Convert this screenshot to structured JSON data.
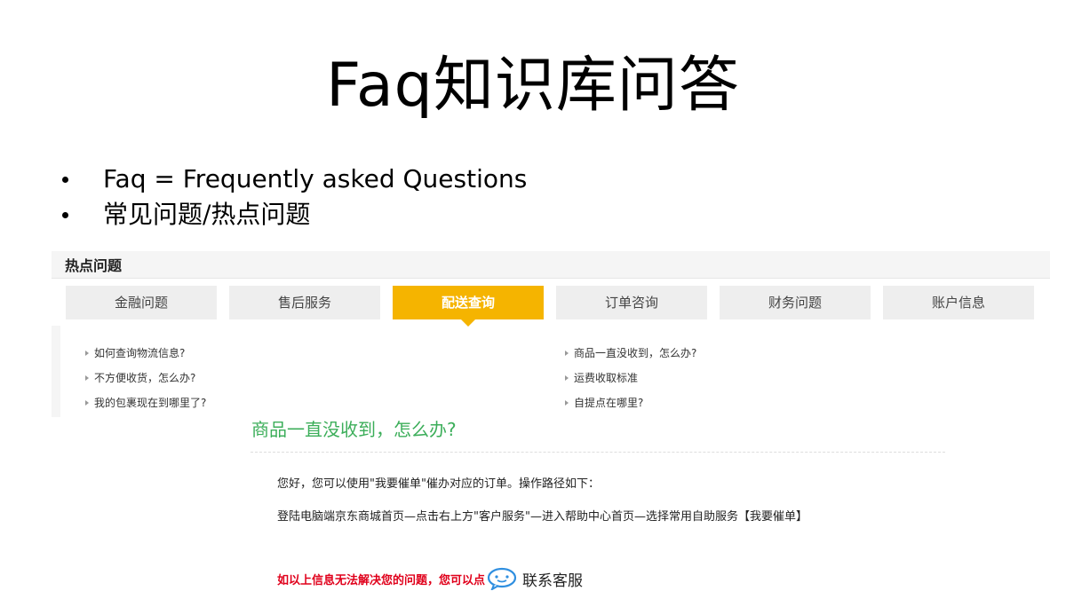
{
  "slide": {
    "title": "Faq知识库问答",
    "bullets": [
      "Faq = Frequently asked Questions",
      "常见问题/热点问题"
    ]
  },
  "hot_questions": {
    "title": "热点问题",
    "tabs": [
      {
        "label": "金融问题",
        "active": false
      },
      {
        "label": "售后服务",
        "active": false
      },
      {
        "label": "配送查询",
        "active": true
      },
      {
        "label": "订单咨询",
        "active": false
      },
      {
        "label": "财务问题",
        "active": false
      },
      {
        "label": "账户信息",
        "active": false
      }
    ],
    "left_questions": [
      "如何查询物流信息?",
      "不方便收货，怎么办?",
      "我的包裹现在到哪里了?"
    ],
    "right_questions": [
      "商品一直没收到，怎么办?",
      "运费收取标准",
      "自提点在哪里?"
    ]
  },
  "answer": {
    "title": "商品一直没收到，怎么办?",
    "p1": "您好，您可以使用\"我要催单\"催办对应的订单。操作路径如下：",
    "p2": "登陆电脑端京东商城首页—点击右上方\"客户服务\"—进入帮助中心首页—选择常用自助服务【我要催单】",
    "footer_note": "如以上信息无法解决您的问题，您可以点",
    "service_link": "联系客服"
  },
  "colors": {
    "active_tab": "#f5b400",
    "answer_title": "#3cae5a",
    "footer_note": "#e0001b",
    "service_icon": "#2f8fe0"
  }
}
